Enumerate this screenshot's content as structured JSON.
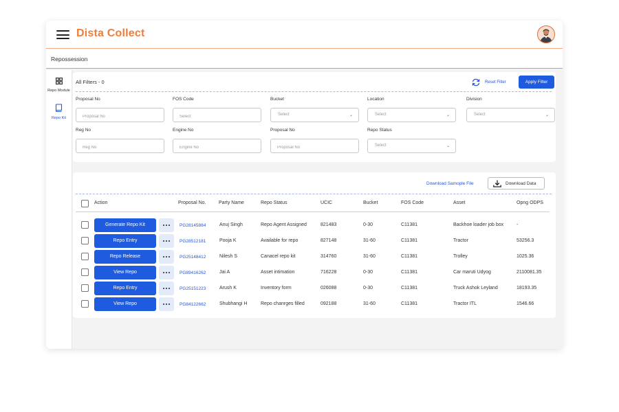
{
  "app": {
    "brand": "Dista Collect"
  },
  "breadcrumb": "Repossession",
  "sidenav": [
    {
      "label": "Repo Module",
      "icon": "grid-icon"
    },
    {
      "label": "Repo Kit",
      "icon": "book-icon"
    }
  ],
  "filters": {
    "title": "All Filters - 0",
    "reset_label": "Reset Filter",
    "apply_label": "Apply Filter",
    "fields": [
      {
        "label": "Proposal No",
        "placeholder": "Proposal No",
        "type": "input"
      },
      {
        "label": "FOS Code",
        "placeholder": "Select",
        "type": "input"
      },
      {
        "label": "Bucket",
        "placeholder": "Select",
        "type": "select"
      },
      {
        "label": "Location",
        "placeholder": "Select",
        "type": "select"
      },
      {
        "label": "Division",
        "placeholder": "Select",
        "type": "select"
      },
      {
        "label": "Reg No",
        "placeholder": "Reg No",
        "type": "input"
      },
      {
        "label": "Engine No",
        "placeholder": "Engine No",
        "type": "input"
      },
      {
        "label": "Proposal No",
        "placeholder": "Proposal No",
        "type": "input"
      },
      {
        "label": "Repo Status",
        "placeholder": "Select",
        "type": "select"
      }
    ]
  },
  "results": {
    "download_sample_label": "Download Samople File",
    "download_data_label": "Download Data",
    "columns": [
      "Action",
      "Proposal No.",
      "Party Name",
      "Repo Status",
      "UCIC",
      "Bucket",
      "FOS Code",
      "Asset",
      "Opng ODPS"
    ],
    "rows": [
      {
        "action": "Generate Repo Kit",
        "proposal": "PG28145884",
        "party": "Anuj Singh",
        "status": "Repo Agent Assigned",
        "ucic": "821483",
        "bucket": "0-30",
        "fos": "C11381",
        "asset": "Backhoe loader job box",
        "odps": "-"
      },
      {
        "action": "Repo Entry",
        "proposal": "PG28512181",
        "party": "Pooja K",
        "status": "Available for repo",
        "ucic": "827148",
        "bucket": "31-60",
        "fos": "C11381",
        "asset": "Tractor",
        "odps": "53256.3"
      },
      {
        "action": "Repo Release",
        "proposal": "PG25148412",
        "party": "Nilesh  S",
        "status": "Canacel repo kit",
        "ucic": "314760",
        "bucket": "31-60",
        "fos": "C11381",
        "asset": "Trolley",
        "odps": "1025.36"
      },
      {
        "action": "View Repo",
        "proposal": "PG89416262",
        "party": "Jai A",
        "status": "Asset intimation",
        "ucic": "716228",
        "bucket": "0-30",
        "fos": "C11381",
        "asset": "Car maruti Udyog",
        "odps": "2110081.35"
      },
      {
        "action": "Repo Entry",
        "proposal": "PG25151223",
        "party": "Arush K",
        "status": "Inventory form",
        "ucic": "026088",
        "bucket": "0-30",
        "fos": "C11381",
        "asset": "Truck Ashok Leyland",
        "odps": "18193.35"
      },
      {
        "action": "View Repo",
        "proposal": "PG84122662",
        "party": "Shubhangi H",
        "status": "Repo chanrges filled",
        "ucic": "092188",
        "bucket": "31-60",
        "fos": "C11381",
        "asset": "Tractor ITL",
        "odps": "1546.66"
      }
    ]
  },
  "colors": {
    "brand": "#f07c3a",
    "primary": "#1f5bde",
    "link": "#2755d6"
  }
}
